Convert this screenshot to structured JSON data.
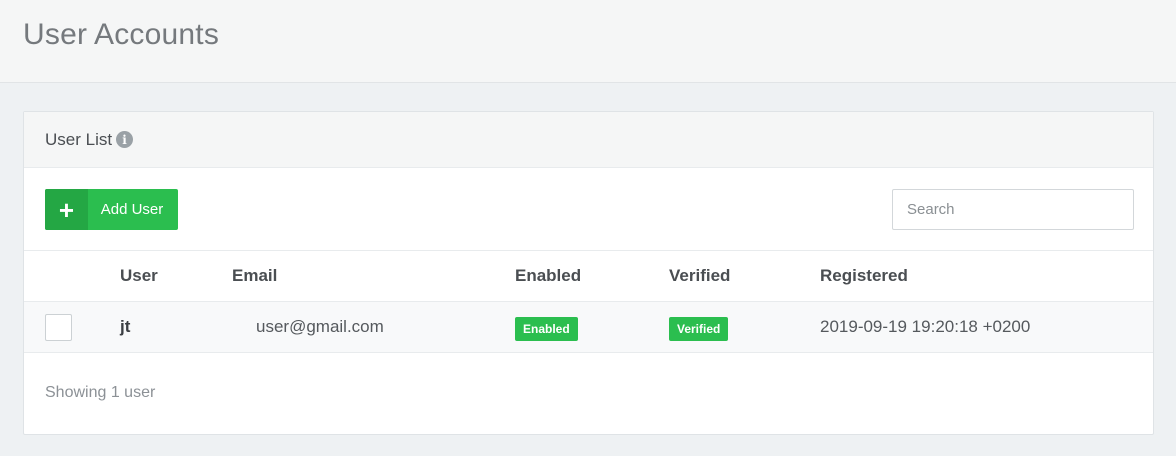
{
  "page": {
    "title": "User Accounts"
  },
  "panel": {
    "title": "User List",
    "info_icon": "info-icon"
  },
  "toolbar": {
    "add_label": "Add User",
    "add_icon": "+",
    "search_placeholder": "Search"
  },
  "table": {
    "columns": [
      "User",
      "Email",
      "Enabled",
      "Verified",
      "Registered"
    ],
    "rows": [
      {
        "user": "jt",
        "email": "user@gmail.com",
        "enabled": "Enabled",
        "verified": "Verified",
        "registered": "2019-09-19 19:20:18 +0200"
      }
    ]
  },
  "footer": {
    "summary": "Showing 1 user"
  },
  "colors": {
    "accent_green": "#2bbe4f",
    "accent_green_dark": "#24a744"
  }
}
